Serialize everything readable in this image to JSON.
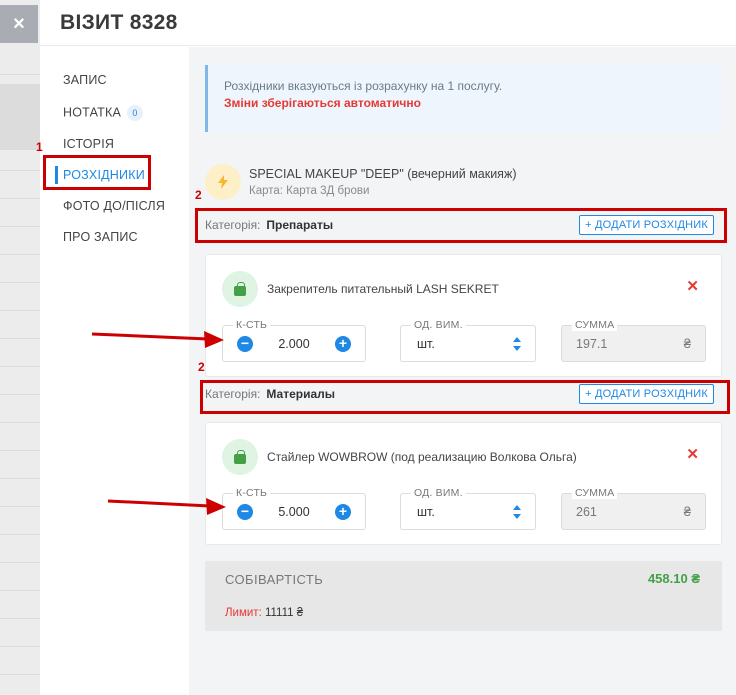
{
  "backdrop": {
    "close_label": "×"
  },
  "modal": {
    "title": "ВІЗИТ 8328"
  },
  "sidenav": {
    "items": [
      {
        "label": "ЗАПИС"
      },
      {
        "label": "НОТАТКА",
        "badge": "0"
      },
      {
        "label": "ІСТОРІЯ"
      },
      {
        "label": "РОЗХІДНИКИ",
        "active": true
      },
      {
        "label": "ФОТО ДО/ПІСЛЯ"
      },
      {
        "label": "ПРО ЗАПИС"
      }
    ]
  },
  "info": {
    "text": "Розхідники вказуються із розрахунку на 1 послугу.",
    "warning": "Зміни зберігаються автоматично"
  },
  "service": {
    "icon": "lightning-icon",
    "name": "SPECIAL MAKEUP \"DEEP\" (вечерний макияж)",
    "card": "Карта: Карта 3Д брови"
  },
  "categories": [
    {
      "label": "Категорія:",
      "value": "Препараты",
      "add_label": "+ ДОДАТИ РОЗХІДНИК",
      "item": {
        "name": "Закрепитель питательный LASH SEKRET",
        "qty_label": "К-СТЬ",
        "qty": "2.000",
        "unit_label": "ОД. ВИМ.",
        "unit": "шт.",
        "sum_label": "СУММА",
        "sum": "197.1",
        "currency": "₴"
      }
    },
    {
      "label": "Категорія:",
      "value": "Материалы",
      "add_label": "+ ДОДАТИ РОЗХІДНИК",
      "item": {
        "name": "Стайлер WOWBROW (под реализацию Волкова Ольга)",
        "qty_label": "К-СТЬ",
        "qty": "5.000",
        "unit_label": "ОД. ВИМ.",
        "unit": "шт.",
        "sum_label": "СУММА",
        "sum": "261",
        "currency": "₴"
      }
    }
  ],
  "cost": {
    "title": "СОБІВАРТІСТЬ",
    "value": "458.10 ₴",
    "limit_label": "Лимит:",
    "limit_value": "11111 ₴"
  },
  "annotations": {
    "n1": "1",
    "n2a": "2",
    "n2b": "2"
  },
  "colors": {
    "accent": "#1e88e5",
    "danger": "#e53935",
    "success": "#43a047",
    "annotation": "#cc0000"
  }
}
